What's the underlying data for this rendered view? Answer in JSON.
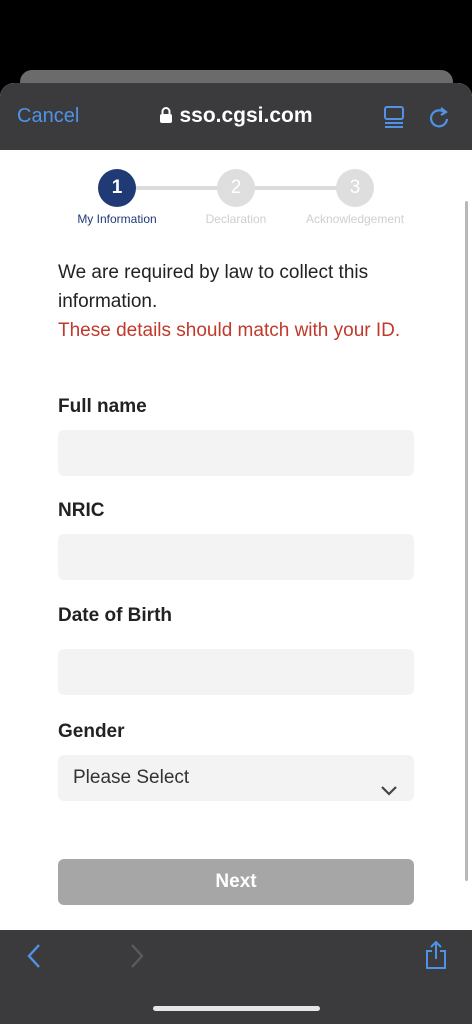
{
  "browser": {
    "cancel_label": "Cancel",
    "url": "sso.cgsi.com"
  },
  "stepper": {
    "steps": [
      {
        "number": "1",
        "label": "My Information",
        "state": "active"
      },
      {
        "number": "2",
        "label": "Declaration",
        "state": "inactive"
      },
      {
        "number": "3",
        "label": "Acknowledgement",
        "state": "inactive"
      }
    ]
  },
  "form": {
    "intro_text": "We are required by law to collect this information.",
    "warning_text": "These details should match with your ID.",
    "fields": {
      "full_name": {
        "label": "Full name",
        "value": ""
      },
      "nric": {
        "label": "NRIC",
        "value": ""
      },
      "dob": {
        "label": "Date of Birth",
        "value": ""
      },
      "gender": {
        "label": "Gender",
        "selected": "Please Select"
      }
    },
    "next_label": "Next"
  },
  "colors": {
    "accent": "#4f93e6",
    "step_active": "#1f3a75",
    "warning": "#c0392b",
    "button_disabled": "#a6a6a6"
  },
  "icons": [
    "lock-icon",
    "reader-view-icon",
    "reload-icon",
    "back-arrow-icon",
    "forward-arrow-icon",
    "share-icon",
    "chevron-down-icon"
  ]
}
